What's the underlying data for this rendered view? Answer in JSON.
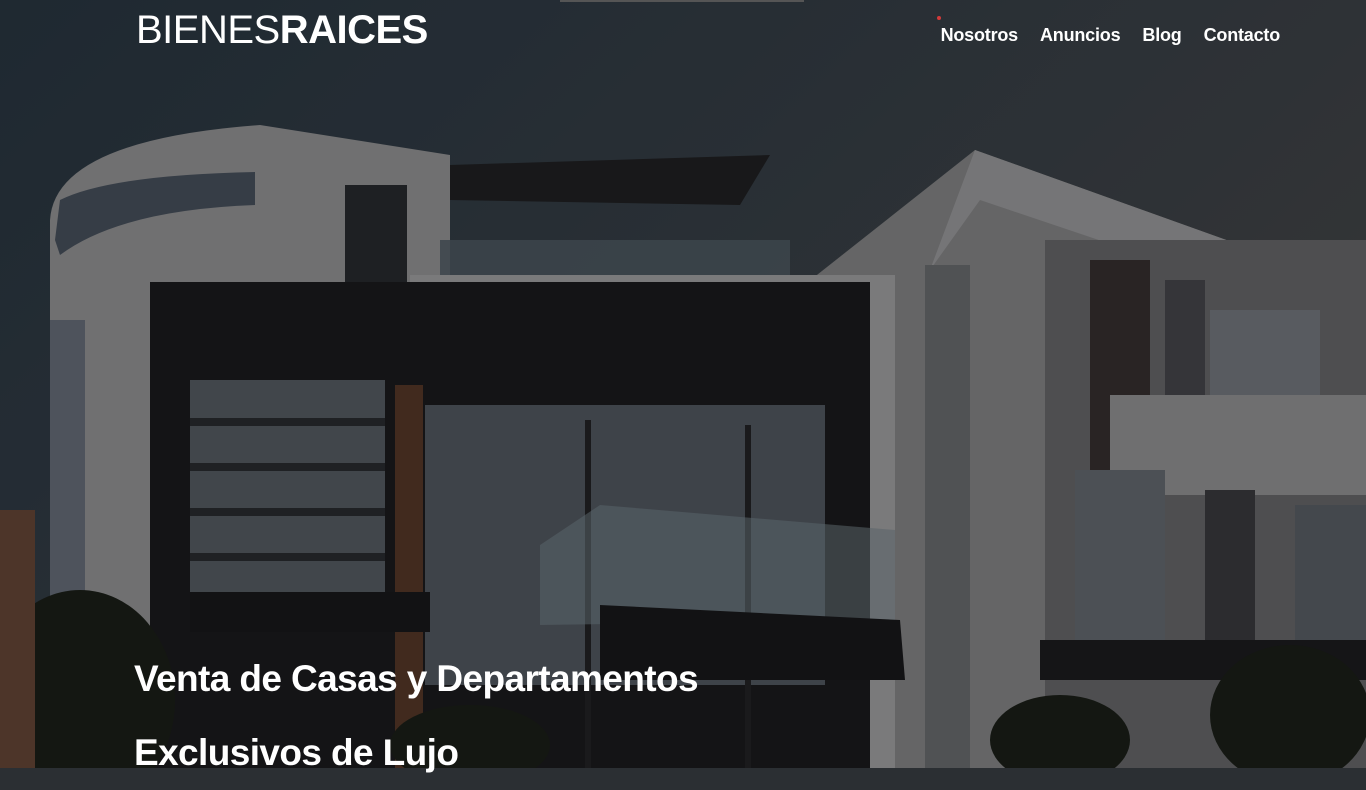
{
  "header": {
    "logo_light": "BIENES",
    "logo_bold": "RAICES",
    "nav": [
      "Nosotros",
      "Anuncios",
      "Blog",
      "Contacto"
    ]
  },
  "hero": {
    "line1": "Venta de Casas y Departamentos",
    "line2": "Exclusivos de Lujo"
  },
  "colors": {
    "text": "#ffffff",
    "accent_dot": "#d33a3a"
  }
}
